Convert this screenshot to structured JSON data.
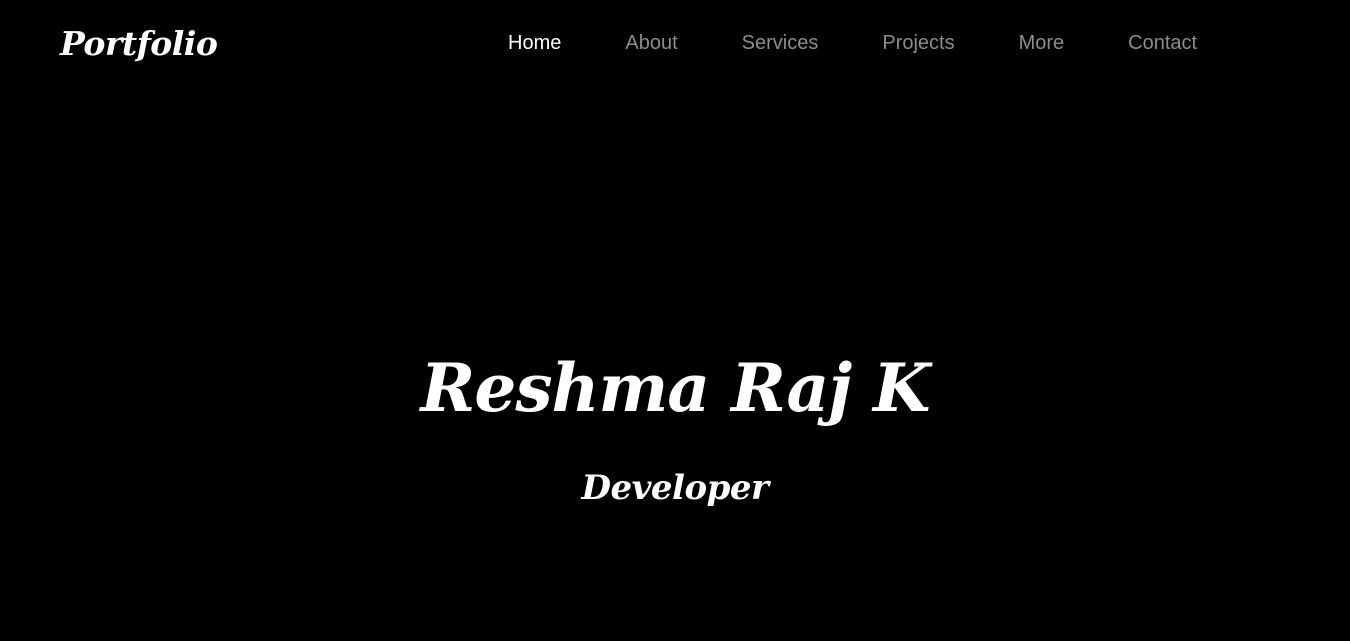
{
  "navbar": {
    "logo": "Portfolio",
    "items": [
      {
        "label": "Home",
        "active": true
      },
      {
        "label": "About",
        "active": false
      },
      {
        "label": "Services",
        "active": false
      },
      {
        "label": "Projects",
        "active": false
      },
      {
        "label": "More",
        "active": false
      },
      {
        "label": "Contact",
        "active": false
      }
    ]
  },
  "hero": {
    "name": "Reshma Raj K",
    "role": "Developer"
  },
  "colors": {
    "background": "#000000",
    "text": "#ffffff",
    "nav_inactive": "#8d8d8d"
  }
}
